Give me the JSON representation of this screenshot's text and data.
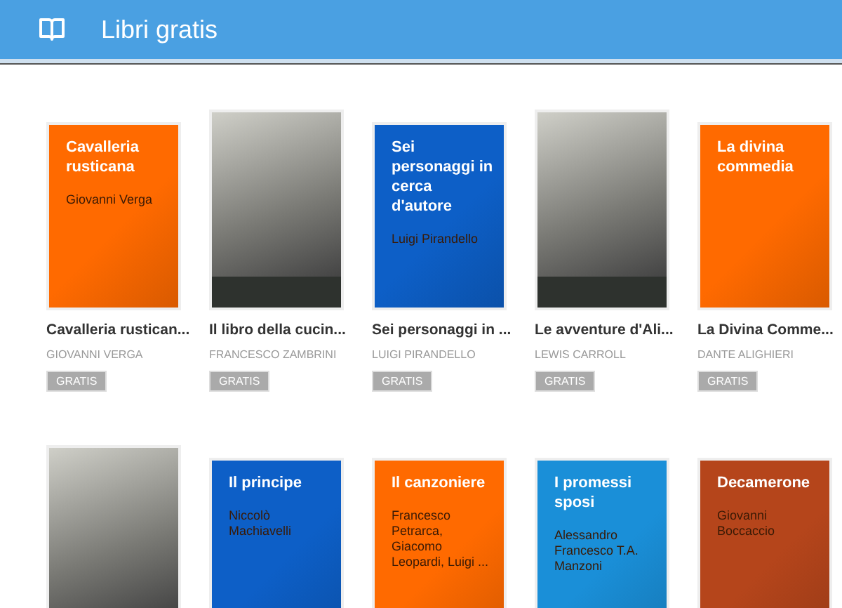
{
  "header": {
    "title": "Libri gratis"
  },
  "books": [
    {
      "cover": {
        "kind": "plain",
        "color": "#ff6a00",
        "title": "Cavalleria rusticana",
        "author": "Giovanni Verga"
      },
      "title": "Cavalleria rustican...",
      "author": "GIOVANNI VERGA",
      "price": "GRATIS"
    },
    {
      "cover": {
        "kind": "illustration"
      },
      "title": "Il libro della cucin...",
      "author": "FRANCESCO ZAMBRINI",
      "price": "GRATIS"
    },
    {
      "cover": {
        "kind": "plain",
        "color": "#0d5fc7",
        "title": "Sei personaggi in cerca d'autore",
        "author": "Luigi Pirandello"
      },
      "title": "Sei personaggi in ...",
      "author": "LUIGI PIRANDELLO",
      "price": "GRATIS"
    },
    {
      "cover": {
        "kind": "illustration"
      },
      "title": "Le avventure d'Ali...",
      "author": "LEWIS CARROLL",
      "price": "GRATIS"
    },
    {
      "cover": {
        "kind": "plain",
        "color": "#ff6a00",
        "title": "La divina commedia"
      },
      "title": "La Divina Comme...",
      "author": "DANTE ALIGHIERI",
      "price": "GRATIS"
    },
    {
      "cover": {
        "kind": "illustration"
      }
    },
    {
      "cover": {
        "kind": "plain",
        "color": "#0d5fc7",
        "title": "Il principe",
        "author": "Niccolò Machiavelli"
      }
    },
    {
      "cover": {
        "kind": "plain",
        "color": "#ff6a00",
        "title": "Il canzoniere",
        "author": "Francesco Petrarca, Giacomo Leopardi, Luigi ..."
      }
    },
    {
      "cover": {
        "kind": "plain",
        "color": "#1a8fd8",
        "title": "I promessi sposi",
        "author": "Alessandro Francesco T.A. Manzoni"
      }
    },
    {
      "cover": {
        "kind": "plain",
        "color": "#b5451b",
        "title": "Decamerone",
        "author": "Giovanni Boccaccio"
      }
    }
  ]
}
